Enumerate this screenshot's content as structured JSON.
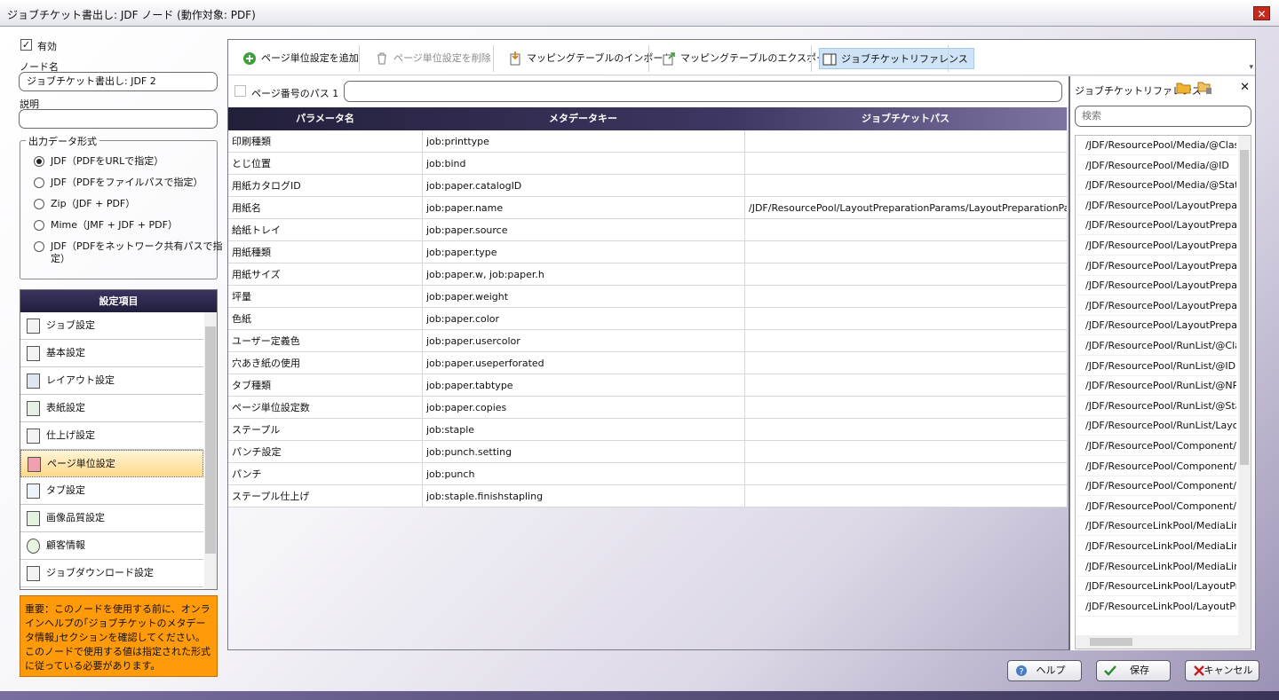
{
  "window": {
    "title": "ジョブチケット書出し: JDF ノード (動作対象: PDF)",
    "close_glyph": "✕"
  },
  "left": {
    "enabled_label": "有効",
    "enabled_mark": "✓",
    "node_name_label": "ノード名",
    "node_name_value": "ジョブチケット書出し: JDF 2",
    "description_label": "説明",
    "description_value": "",
    "output_group_label": "出力データ形式",
    "output_options": [
      "JDF（PDFをURLで指定）",
      "JDF（PDFをファイルパスで指定）",
      "Zip（JDF + PDF）",
      "Mime（JMF + JDF + PDF）",
      "JDF（PDFをネットワーク共有パスで指",
      "定）"
    ],
    "settings_header": "設定項目",
    "settings_items": [
      "ジョブ設定",
      "基本設定",
      "レイアウト設定",
      "表紙設定",
      "仕上げ設定",
      "ページ単位設定",
      "タブ設定",
      "画像品質設定",
      "顧客情報",
      "ジョブダウンロード設定"
    ],
    "notice": "重要：このノードを使用する前に、オンラインヘルプの｢ジョブチケットのメタデータ情報｣セクションを確認してください。このノードで使用する値は指定された形式に従っている必要があります。"
  },
  "toolbar": {
    "add": "ページ単位設定を追加",
    "delete": "ページ単位設定を削除",
    "import": "マッピングテーブルのインポート",
    "export": "マッピングテーブルのエクスポート",
    "reference": "ジョブチケットリファレンス"
  },
  "path": {
    "label": "ページ番号のパス 1",
    "value": ""
  },
  "grid": {
    "headers": [
      "パラメータ名",
      "メタデータキー",
      "ジョブチケットパス"
    ],
    "rows": [
      [
        "印刷種類",
        "job:printtype",
        ""
      ],
      [
        "とじ位置",
        "job:bind",
        ""
      ],
      [
        "用紙カタログID",
        "job:paper.catalogID",
        ""
      ],
      [
        "用紙名",
        "job:paper.name",
        "/JDF/ResourcePool/LayoutPreparationParams/LayoutPreparationParam"
      ],
      [
        "給紙トレイ",
        "job:paper.source",
        ""
      ],
      [
        "用紙種類",
        "job:paper.type",
        ""
      ],
      [
        "用紙サイズ",
        "job:paper.w, job:paper.h",
        ""
      ],
      [
        "坪量",
        "job:paper.weight",
        ""
      ],
      [
        "色紙",
        "job:paper.color",
        ""
      ],
      [
        "ユーザー定義色",
        "job:paper.usercolor",
        ""
      ],
      [
        "穴あき紙の使用",
        "job:paper.useperforated",
        ""
      ],
      [
        "タブ種類",
        "job:paper.tabtype",
        ""
      ],
      [
        "ページ単位設定数",
        "job:paper.copies",
        ""
      ],
      [
        "ステープル",
        "job:staple",
        ""
      ],
      [
        "パンチ設定",
        "job:punch.setting",
        ""
      ],
      [
        "パンチ",
        "job:punch",
        ""
      ],
      [
        "ステープル仕上げ",
        "job:staple.finishstapling",
        ""
      ]
    ]
  },
  "reference": {
    "title": "ジョブチケットリファレンス",
    "close_glyph": "✕",
    "search_placeholder": "検索",
    "items": [
      "/JDF/ResourcePool/Media/@Class",
      "/JDF/ResourcePool/Media/@ID",
      "/JDF/ResourcePool/Media/@Status",
      "/JDF/ResourcePool/LayoutPrepara",
      "/JDF/ResourcePool/LayoutPrepara",
      "/JDF/ResourcePool/LayoutPrepara",
      "/JDF/ResourcePool/LayoutPrepara",
      "/JDF/ResourcePool/LayoutPrepara",
      "/JDF/ResourcePool/LayoutPrepara",
      "/JDF/ResourcePool/LayoutPrepara",
      "/JDF/ResourcePool/RunList/@Clas",
      "/JDF/ResourcePool/RunList/@ID",
      "/JDF/ResourcePool/RunList/@NPa",
      "/JDF/ResourcePool/RunList/@Stat",
      "/JDF/ResourcePool/RunList/Layou",
      "/JDF/ResourcePool/Component/@",
      "/JDF/ResourcePool/Component/@",
      "/JDF/ResourcePool/Component/@",
      "/JDF/ResourcePool/Component/@",
      "/JDF/ResourceLinkPool/MediaLink",
      "/JDF/ResourceLinkPool/MediaLink",
      "/JDF/ResourceLinkPool/MediaLink",
      "/JDF/ResourceLinkPool/LayoutPre",
      "/JDF/ResourceLinkPool/LayoutPre"
    ]
  },
  "buttons": {
    "help": "ヘルプ",
    "save": "保存",
    "cancel": "キャンセル"
  },
  "colors": {
    "accent": "#2b2645",
    "notice_bg": "#ff9a0a",
    "selected_item": "#ffd98a"
  }
}
